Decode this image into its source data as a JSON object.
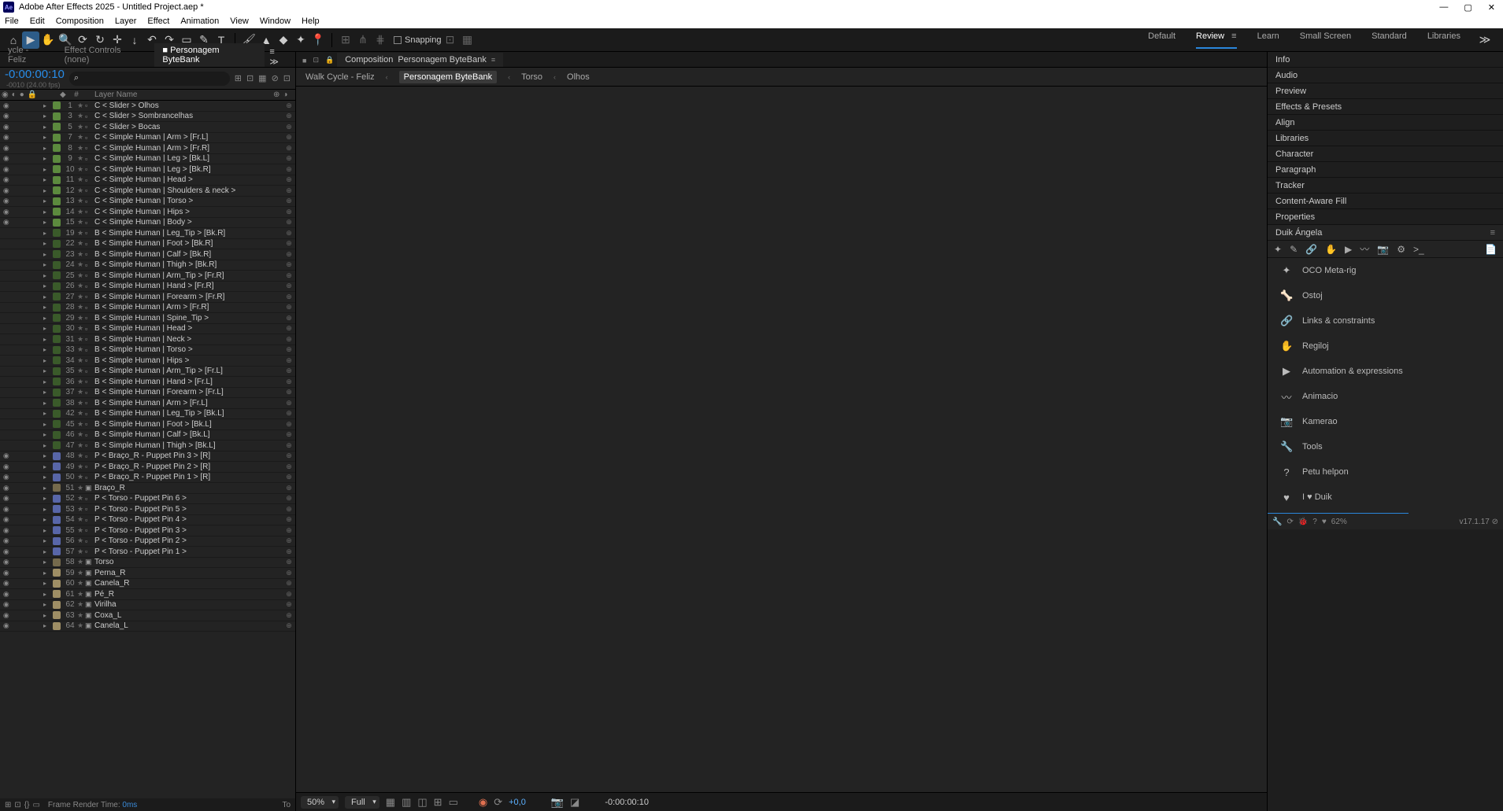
{
  "titlebar": {
    "app": "Adobe After Effects 2025",
    "project": "Untitled Project.aep *"
  },
  "menu": [
    "File",
    "Edit",
    "Composition",
    "Layer",
    "Effect",
    "Animation",
    "View",
    "Window",
    "Help"
  ],
  "snapping_label": "Snapping",
  "workspaces": [
    "Default",
    "Review",
    "Learn",
    "Small Screen",
    "Standard",
    "Libraries"
  ],
  "workspace_active": "Review",
  "left_tabs": {
    "tab1": "ycle - Feliz",
    "tab2": "Effect Controls (none)",
    "tab_active": "Personagem ByteBank"
  },
  "timecode": "-0:00:00:10",
  "timecode_sub": "-0010 (24.00 fps)",
  "search_placeholder": "",
  "tl_cols": {
    "num": "#",
    "layer": "Layer Name"
  },
  "footer": {
    "render_label": "Frame Render Time:",
    "render_val": "0ms",
    "right": "To"
  },
  "comp": {
    "tab_prefix": "Composition",
    "tab_name": "Personagem ByteBank",
    "breadcrumb": [
      "Walk Cycle - Feliz",
      "Personagem ByteBank",
      "Torso",
      "Olhos"
    ],
    "breadcrumb_active": "Personagem ByteBank",
    "mag": "50%",
    "res": "Full",
    "exposure": "+0,0",
    "time": "-0:00:00:10"
  },
  "right_panels": [
    "Info",
    "Audio",
    "Preview",
    "Effects & Presets",
    "Align",
    "Libraries",
    "Character",
    "Paragraph",
    "Tracker",
    "Content-Aware Fill",
    "Properties",
    "Duik Ángela"
  ],
  "duik": {
    "items": [
      {
        "icon": "✦",
        "label": "OCO Meta-rig"
      },
      {
        "icon": "🦴",
        "label": "Ostoj"
      },
      {
        "icon": "🔗",
        "label": "Links & constraints"
      },
      {
        "icon": "✋",
        "label": "Regiloj"
      },
      {
        "icon": "▶",
        "label": "Automation & expressions"
      },
      {
        "icon": "〰",
        "label": "Animacio"
      },
      {
        "icon": "📷",
        "label": "Kamerao"
      },
      {
        "icon": "🔧",
        "label": "Tools"
      },
      {
        "icon": "?",
        "label": "Petu helpon"
      },
      {
        "icon": "♥",
        "label": "I ♥ Duik"
      }
    ],
    "pct": "62%",
    "ver": "v17.1.17"
  },
  "layers": [
    {
      "n": 1,
      "c": "green",
      "name": "C < Slider > Olhos",
      "vis": true
    },
    {
      "n": 3,
      "c": "green",
      "name": "C < Slider > Sombrancelhas",
      "vis": true
    },
    {
      "n": 5,
      "c": "green",
      "name": "C < Slider > Bocas",
      "vis": true
    },
    {
      "n": 7,
      "c": "green",
      "name": "C < Simple Human | Arm > [Fr.L]",
      "vis": true
    },
    {
      "n": 8,
      "c": "green",
      "name": "C < Simple Human | Arm > [Fr.R]",
      "vis": true
    },
    {
      "n": 9,
      "c": "green",
      "name": "C < Simple Human | Leg > [Bk.L]",
      "vis": true
    },
    {
      "n": 10,
      "c": "green",
      "name": "C < Simple Human | Leg > [Bk.R]",
      "vis": true
    },
    {
      "n": 11,
      "c": "green",
      "name": "C < Simple Human | Head >",
      "vis": true
    },
    {
      "n": 12,
      "c": "green",
      "name": "C < Simple Human | Shoulders & neck >",
      "vis": true
    },
    {
      "n": 13,
      "c": "green",
      "name": "C < Simple Human | Torso >",
      "vis": true
    },
    {
      "n": 14,
      "c": "green",
      "name": "C < Simple Human | Hips >",
      "vis": true
    },
    {
      "n": 15,
      "c": "green",
      "name": "C < Simple Human | Body >",
      "vis": true
    },
    {
      "n": 19,
      "c": "dgreen",
      "name": "B < Simple Human | Leg_Tip > [Bk.R]",
      "vis": false
    },
    {
      "n": 22,
      "c": "dgreen",
      "name": "B < Simple Human | Foot > [Bk.R]",
      "vis": false
    },
    {
      "n": 23,
      "c": "dgreen",
      "name": "B < Simple Human | Calf > [Bk.R]",
      "vis": false
    },
    {
      "n": 24,
      "c": "dgreen",
      "name": "B < Simple Human | Thigh > [Bk.R]",
      "vis": false
    },
    {
      "n": 25,
      "c": "dgreen",
      "name": "B < Simple Human | Arm_Tip > [Fr.R]",
      "vis": false
    },
    {
      "n": 26,
      "c": "dgreen",
      "name": "B < Simple Human | Hand > [Fr.R]",
      "vis": false
    },
    {
      "n": 27,
      "c": "dgreen",
      "name": "B < Simple Human | Forearm > [Fr.R]",
      "vis": false
    },
    {
      "n": 28,
      "c": "dgreen",
      "name": "B < Simple Human | Arm > [Fr.R]",
      "vis": false
    },
    {
      "n": 29,
      "c": "dgreen",
      "name": "B < Simple Human | Spine_Tip >",
      "vis": false
    },
    {
      "n": 30,
      "c": "dgreen",
      "name": "B < Simple Human | Head >",
      "vis": false
    },
    {
      "n": 31,
      "c": "dgreen",
      "name": "B < Simple Human | Neck >",
      "vis": false
    },
    {
      "n": 33,
      "c": "dgreen",
      "name": "B < Simple Human | Torso >",
      "vis": false
    },
    {
      "n": 34,
      "c": "dgreen",
      "name": "B < Simple Human | Hips >",
      "vis": false
    },
    {
      "n": 35,
      "c": "dgreen",
      "name": "B < Simple Human | Arm_Tip > [Fr.L]",
      "vis": false
    },
    {
      "n": 36,
      "c": "dgreen",
      "name": "B < Simple Human | Hand > [Fr.L]",
      "vis": false
    },
    {
      "n": 37,
      "c": "dgreen",
      "name": "B < Simple Human | Forearm > [Fr.L]",
      "vis": false
    },
    {
      "n": 38,
      "c": "dgreen",
      "name": "B < Simple Human | Arm > [Fr.L]",
      "vis": false
    },
    {
      "n": 42,
      "c": "dgreen",
      "name": "B < Simple Human | Leg_Tip > [Bk.L]",
      "vis": false
    },
    {
      "n": 45,
      "c": "dgreen",
      "name": "B < Simple Human | Foot > [Bk.L]",
      "vis": false
    },
    {
      "n": 46,
      "c": "dgreen",
      "name": "B < Simple Human | Calf > [Bk.L]",
      "vis": false
    },
    {
      "n": 47,
      "c": "dgreen",
      "name": "B < Simple Human | Thigh > [Bk.L]",
      "vis": false
    },
    {
      "n": 48,
      "c": "blue",
      "name": "P < Braço_R - Puppet Pin 3 > [R]",
      "vis": true
    },
    {
      "n": 49,
      "c": "blue",
      "name": "P < Braço_R - Puppet Pin 2 > [R]",
      "vis": true
    },
    {
      "n": 50,
      "c": "blue",
      "name": "P < Braço_R - Puppet Pin 1 > [R]",
      "vis": true
    },
    {
      "n": 51,
      "c": "brown",
      "name": "Braço_R",
      "vis": true,
      "comp": true
    },
    {
      "n": 52,
      "c": "blue",
      "name": "P < Torso - Puppet Pin 6 >",
      "vis": true
    },
    {
      "n": 53,
      "c": "blue",
      "name": "P < Torso - Puppet Pin 5 >",
      "vis": true
    },
    {
      "n": 54,
      "c": "blue",
      "name": "P < Torso - Puppet Pin 4 >",
      "vis": true
    },
    {
      "n": 55,
      "c": "blue",
      "name": "P < Torso - Puppet Pin 3 >",
      "vis": true
    },
    {
      "n": 56,
      "c": "blue",
      "name": "P < Torso - Puppet Pin 2 >",
      "vis": true
    },
    {
      "n": 57,
      "c": "blue",
      "name": "P < Torso - Puppet Pin 1 >",
      "vis": true
    },
    {
      "n": 58,
      "c": "brown",
      "name": "Torso",
      "vis": true,
      "comp": true
    },
    {
      "n": 59,
      "c": "sandy",
      "name": "Perna_R",
      "vis": true,
      "comp": true
    },
    {
      "n": 60,
      "c": "sandy",
      "name": "Canela_R",
      "vis": true,
      "comp": true
    },
    {
      "n": 61,
      "c": "sandy",
      "name": "Pé_R",
      "vis": true,
      "comp": true
    },
    {
      "n": 62,
      "c": "sandy",
      "name": "Virilha",
      "vis": true,
      "comp": true
    },
    {
      "n": 63,
      "c": "sandy",
      "name": "Coxa_L",
      "vis": true,
      "comp": true
    },
    {
      "n": 64,
      "c": "sandy",
      "name": "Canela_L",
      "vis": true,
      "comp": true
    }
  ]
}
